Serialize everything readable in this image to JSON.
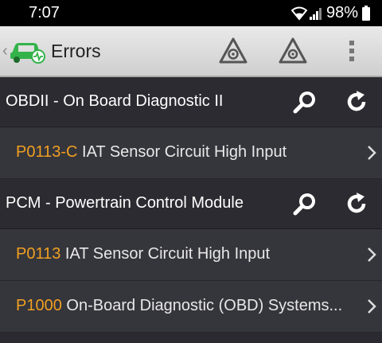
{
  "status_bar": {
    "time": "7:07",
    "battery": "98%",
    "icons": [
      "wifi-icon",
      "signal-icon",
      "battery-icon"
    ]
  },
  "app_bar": {
    "title": "Errors",
    "actions": [
      "clear-errors-icon",
      "clear-errors-all-icon",
      "more-options-icon"
    ]
  },
  "colors": {
    "code": "#f0a020",
    "logo_green": "#33b34a",
    "module_bg": "#2b2b31",
    "error_bg": "#35353c"
  },
  "modules": [
    {
      "name": "OBDII - On Board Diagnostic II",
      "errors": [
        {
          "code": "P0113-C",
          "description": "IAT Sensor Circuit High Input"
        }
      ]
    },
    {
      "name": "PCM - Powertrain Control Module",
      "errors": [
        {
          "code": "P0113",
          "description": "IAT Sensor Circuit High Input"
        },
        {
          "code": "P1000",
          "description": "On-Board Diagnostic (OBD) Systems..."
        }
      ]
    }
  ]
}
